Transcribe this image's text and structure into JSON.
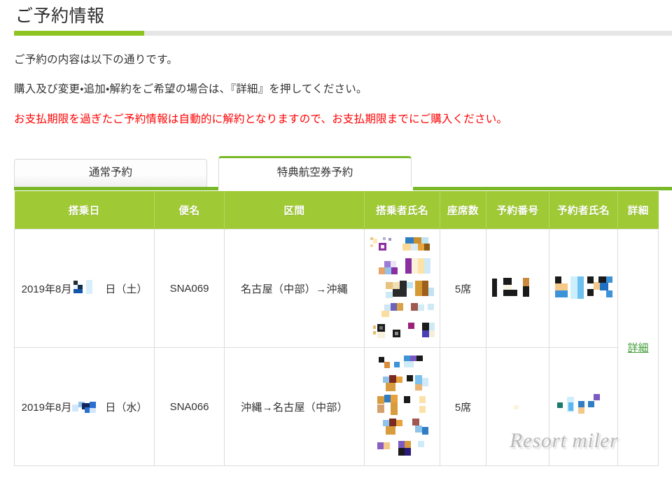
{
  "page": {
    "title": "ご予約情報",
    "accent_green": "#8dc322",
    "rule_gray": "#e6e6e6",
    "warning_color": "#ff0000",
    "header_green": "#a0ca35",
    "tab_bar_green": "#79b827",
    "link_green": "#3f9c35"
  },
  "intro": {
    "line1": "ご予約の内容は以下の通りです。",
    "line2": "購入及び変更・追加・解約をご希望の場合は、『詳細』を押してください。",
    "warning": "お支払期限を過ぎたご予約情報は自動的に解約となりますので、お支払期限までにご購入ください。"
  },
  "tabs": [
    {
      "label": "通常予約",
      "active": false
    },
    {
      "label": "特典航空券予約",
      "active": true
    }
  ],
  "table": {
    "headers": [
      "搭乗日",
      "便名",
      "区間",
      "搭乗者氏名",
      "座席数",
      "予約番号",
      "予約者氏名",
      "詳細"
    ],
    "rows": [
      {
        "date_prefix": "2019年8月",
        "date_suffix": "日（土）",
        "date_redacted": true,
        "flight": "SNA069",
        "route": "名古屋（中部）→沖縄",
        "passenger_names": "[redacted]",
        "seats": "5席",
        "booking_number": "[redacted]",
        "reserver_name": "[redacted]"
      },
      {
        "date_prefix": "2019年8月",
        "date_suffix": "日（水）",
        "date_redacted": true,
        "flight": "SNA066",
        "route": "沖縄→名古屋（中部）",
        "passenger_names": "[redacted]",
        "seats": "5席",
        "booking_number": "[redacted]",
        "reserver_name": "[redacted]"
      }
    ],
    "detail_link": "詳細"
  },
  "watermark": "Resort miler"
}
